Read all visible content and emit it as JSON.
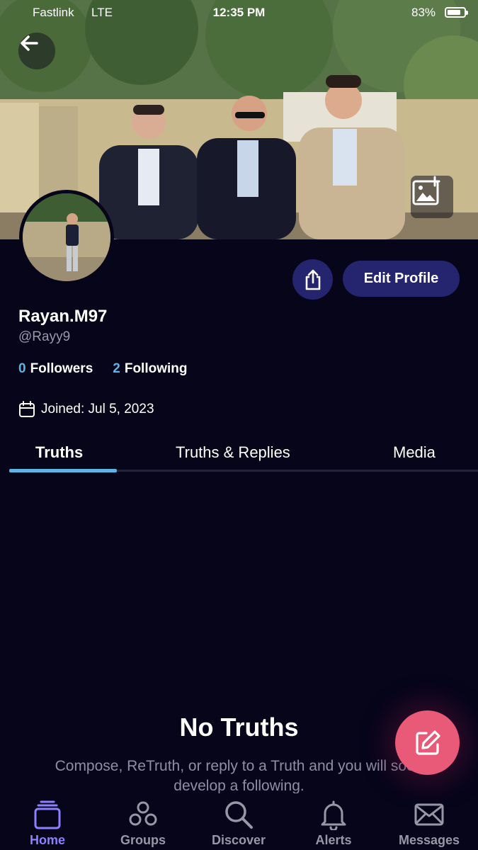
{
  "status_bar": {
    "carrier": "Fastlink",
    "network": "LTE",
    "time": "12:35 PM",
    "battery_percent": "83%",
    "battery_level": 0.83
  },
  "profile": {
    "display_name": "Rayan.M97",
    "handle": "@Rayy9",
    "followers_count": "0",
    "followers_label": "Followers",
    "following_count": "2",
    "following_label": "Following",
    "joined": "Joined: Jul 5, 2023",
    "edit_label": "Edit Profile"
  },
  "tabs": [
    {
      "label": "Truths",
      "active": true
    },
    {
      "label": "Truths & Replies",
      "active": false
    },
    {
      "label": "Media",
      "active": false
    }
  ],
  "empty_state": {
    "title": "No Truths",
    "text": "Compose, ReTruth, or reply to a Truth and you will soon develop a following."
  },
  "bottom_nav": [
    {
      "label": "Home",
      "icon": "home-icon",
      "active": true
    },
    {
      "label": "Groups",
      "icon": "groups-icon",
      "active": false
    },
    {
      "label": "Discover",
      "icon": "search-icon",
      "active": false
    },
    {
      "label": "Alerts",
      "icon": "bell-icon",
      "active": false
    },
    {
      "label": "Messages",
      "icon": "mail-icon",
      "active": false
    }
  ],
  "colors": {
    "background": "#06051a",
    "accent": "#5fb4e6",
    "button": "#25246e",
    "fab": "#e85a78",
    "nav_active": "#8c80ff"
  }
}
